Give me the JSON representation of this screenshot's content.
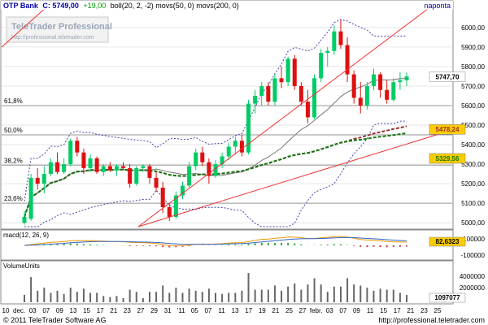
{
  "header": {
    "symbol": "OTP Bank",
    "close_label": "C: 5749,00",
    "change": "+19,00",
    "indicators": "boll(20, 2, -2) movs(50, 0) movs(200, 0)",
    "period": "naponta"
  },
  "watermark": {
    "title": "TeleTrader Professional",
    "url": "http://professional.teletrader.com"
  },
  "footer": {
    "copyright": "© 2011 TeleTrader Software AG",
    "url": "http://professional.teletrader.com"
  },
  "colors": {
    "up": "#00cc66",
    "down": "#dd1111",
    "boll": "#4444aa",
    "ma50": "#993333",
    "ma200": "#117711",
    "trend": "#ee3333",
    "panel_bg": "#ffffff",
    "grid": "#e6e6e6",
    "label_bg": "#ffcc00",
    "macd_label_bg": "#ffcc00"
  },
  "chart_data": [
    {
      "type": "candlestick",
      "title": "OTP Bank",
      "ylim": [
        4980,
        6120
      ],
      "y_ticks": [
        5000,
        5100,
        5200,
        5300,
        5400,
        5500,
        5600,
        5700,
        5800,
        5900,
        6000
      ],
      "y_tick_labels": [
        "5000,00",
        "5100,00",
        "5200,00",
        "5300,00",
        "5400,00",
        "5500,00",
        "5600,00",
        "5700,00",
        "5800,00",
        "5900,00",
        "6000,00"
      ],
      "fib_levels": [
        {
          "label": "61,8%",
          "value": 5600
        },
        {
          "label": "50,0%",
          "value": 5450
        },
        {
          "label": "38,2%",
          "value": 5295
        },
        {
          "label": "23,6%",
          "value": 5100
        }
      ],
      "last_value_labels": [
        {
          "text": "5747,70",
          "value": 5747.7,
          "kind": "price"
        },
        {
          "text": "5478,24",
          "value": 5478.24,
          "kind": "ma50"
        },
        {
          "text": "5329,56",
          "value": 5329.56,
          "kind": "ma200"
        }
      ],
      "candles": [
        {
          "d": "2010-11-30",
          "o": 5000,
          "h": 5060,
          "l": 4990,
          "c": 5030
        },
        {
          "d": "2010-12-01",
          "o": 5020,
          "h": 5250,
          "l": 5010,
          "c": 5230
        },
        {
          "d": "2010-12-02",
          "o": 5230,
          "h": 5280,
          "l": 5170,
          "c": 5200
        },
        {
          "d": "2010-12-03",
          "o": 5200,
          "h": 5290,
          "l": 5150,
          "c": 5250
        },
        {
          "d": "2010-12-06",
          "o": 5250,
          "h": 5330,
          "l": 5240,
          "c": 5310
        },
        {
          "d": "2010-12-07",
          "o": 5310,
          "h": 5360,
          "l": 5250,
          "c": 5260
        },
        {
          "d": "2010-12-08",
          "o": 5260,
          "h": 5330,
          "l": 5250,
          "c": 5300
        },
        {
          "d": "2010-12-09",
          "o": 5300,
          "h": 5430,
          "l": 5290,
          "c": 5420
        },
        {
          "d": "2010-12-10",
          "o": 5420,
          "h": 5440,
          "l": 5340,
          "c": 5360
        },
        {
          "d": "2010-12-13",
          "o": 5360,
          "h": 5380,
          "l": 5250,
          "c": 5280
        },
        {
          "d": "2010-12-14",
          "o": 5280,
          "h": 5350,
          "l": 5260,
          "c": 5330
        },
        {
          "d": "2010-12-15",
          "o": 5330,
          "h": 5340,
          "l": 5250,
          "c": 5260
        },
        {
          "d": "2010-12-16",
          "o": 5260,
          "h": 5300,
          "l": 5240,
          "c": 5290
        },
        {
          "d": "2010-12-17",
          "o": 5290,
          "h": 5310,
          "l": 5260,
          "c": 5270
        },
        {
          "d": "2010-12-20",
          "o": 5270,
          "h": 5300,
          "l": 5240,
          "c": 5290
        },
        {
          "d": "2010-12-21",
          "o": 5290,
          "h": 5310,
          "l": 5270,
          "c": 5280
        },
        {
          "d": "2010-12-22",
          "o": 5280,
          "h": 5300,
          "l": 5180,
          "c": 5200
        },
        {
          "d": "2010-12-23",
          "o": 5200,
          "h": 5290,
          "l": 5190,
          "c": 5280
        },
        {
          "d": "2010-12-24",
          "o": 5280,
          "h": 5300,
          "l": 5260,
          "c": 5290
        },
        {
          "d": "2010-12-27",
          "o": 5290,
          "h": 5300,
          "l": 5200,
          "c": 5230
        },
        {
          "d": "2010-12-28",
          "o": 5230,
          "h": 5260,
          "l": 5160,
          "c": 5180
        },
        {
          "d": "2010-12-29",
          "o": 5180,
          "h": 5210,
          "l": 5050,
          "c": 5080
        },
        {
          "d": "2010-12-30",
          "o": 5080,
          "h": 5100,
          "l": 5010,
          "c": 5030
        },
        {
          "d": "2010-12-31",
          "o": 5030,
          "h": 5160,
          "l": 5020,
          "c": 5140
        },
        {
          "d": "2011-01-03",
          "o": 5140,
          "h": 5210,
          "l": 5120,
          "c": 5190
        },
        {
          "d": "2011-01-04",
          "o": 5190,
          "h": 5310,
          "l": 5180,
          "c": 5290
        },
        {
          "d": "2011-01-05",
          "o": 5290,
          "h": 5380,
          "l": 5270,
          "c": 5360
        },
        {
          "d": "2011-01-06",
          "o": 5360,
          "h": 5390,
          "l": 5290,
          "c": 5310
        },
        {
          "d": "2011-01-07",
          "o": 5310,
          "h": 5330,
          "l": 5200,
          "c": 5240
        },
        {
          "d": "2011-01-10",
          "o": 5240,
          "h": 5320,
          "l": 5230,
          "c": 5300
        },
        {
          "d": "2011-01-11",
          "o": 5300,
          "h": 5360,
          "l": 5280,
          "c": 5340
        },
        {
          "d": "2011-01-12",
          "o": 5340,
          "h": 5410,
          "l": 5320,
          "c": 5390
        },
        {
          "d": "2011-01-13",
          "o": 5390,
          "h": 5440,
          "l": 5350,
          "c": 5420
        },
        {
          "d": "2011-01-14",
          "o": 5420,
          "h": 5450,
          "l": 5340,
          "c": 5360
        },
        {
          "d": "2011-01-17",
          "o": 5360,
          "h": 5630,
          "l": 5350,
          "c": 5610
        },
        {
          "d": "2011-01-18",
          "o": 5610,
          "h": 5680,
          "l": 5560,
          "c": 5650
        },
        {
          "d": "2011-01-19",
          "o": 5650,
          "h": 5720,
          "l": 5600,
          "c": 5700
        },
        {
          "d": "2011-01-20",
          "o": 5700,
          "h": 5720,
          "l": 5600,
          "c": 5620
        },
        {
          "d": "2011-01-21",
          "o": 5620,
          "h": 5760,
          "l": 5600,
          "c": 5740
        },
        {
          "d": "2011-01-24",
          "o": 5740,
          "h": 5800,
          "l": 5690,
          "c": 5720
        },
        {
          "d": "2011-01-25",
          "o": 5720,
          "h": 5850,
          "l": 5700,
          "c": 5840
        },
        {
          "d": "2011-01-26",
          "o": 5840,
          "h": 5860,
          "l": 5680,
          "c": 5700
        },
        {
          "d": "2011-01-27",
          "o": 5700,
          "h": 5720,
          "l": 5600,
          "c": 5620
        },
        {
          "d": "2011-01-28",
          "o": 5620,
          "h": 5680,
          "l": 5510,
          "c": 5540
        },
        {
          "d": "2011-01-31",
          "o": 5540,
          "h": 5760,
          "l": 5530,
          "c": 5740
        },
        {
          "d": "2011-02-01",
          "o": 5740,
          "h": 5890,
          "l": 5720,
          "c": 5870
        },
        {
          "d": "2011-02-02",
          "o": 5870,
          "h": 5900,
          "l": 5800,
          "c": 5880
        },
        {
          "d": "2011-02-03",
          "o": 5880,
          "h": 6010,
          "l": 5860,
          "c": 5980
        },
        {
          "d": "2011-02-04",
          "o": 5980,
          "h": 6040,
          "l": 5890,
          "c": 5910
        },
        {
          "d": "2011-02-07",
          "o": 5910,
          "h": 5950,
          "l": 5720,
          "c": 5760
        },
        {
          "d": "2011-02-08",
          "o": 5760,
          "h": 5780,
          "l": 5610,
          "c": 5640
        },
        {
          "d": "2011-02-09",
          "o": 5640,
          "h": 5720,
          "l": 5560,
          "c": 5600
        },
        {
          "d": "2011-02-10",
          "o": 5600,
          "h": 5720,
          "l": 5580,
          "c": 5700
        },
        {
          "d": "2011-02-11",
          "o": 5700,
          "h": 5790,
          "l": 5680,
          "c": 5760
        },
        {
          "d": "2011-02-14",
          "o": 5760,
          "h": 5770,
          "l": 5640,
          "c": 5680
        },
        {
          "d": "2011-02-15",
          "o": 5680,
          "h": 5730,
          "l": 5610,
          "c": 5630
        },
        {
          "d": "2011-02-16",
          "o": 5630,
          "h": 5740,
          "l": 5620,
          "c": 5720
        },
        {
          "d": "2011-02-17",
          "o": 5720,
          "h": 5770,
          "l": 5680,
          "c": 5730
        },
        {
          "d": "2011-02-18",
          "o": 5730,
          "h": 5770,
          "l": 5700,
          "c": 5749
        }
      ]
    },
    {
      "type": "line",
      "title": "macd(12, 26, 9)",
      "y_tick_labels": [
        "100000",
        "-100000"
      ],
      "last_value_labels": [
        {
          "text": "82,6323",
          "kind": "macd"
        }
      ]
    },
    {
      "type": "bar",
      "title": "VolumeUnits",
      "y_tick_labels": [
        "4000000",
        "2000000"
      ],
      "last_value_labels": [
        {
          "text": "1097077",
          "kind": "volume"
        }
      ]
    }
  ],
  "x_axis": {
    "labels": [
      "10",
      "dec.",
      "03",
      "07",
      "09",
      "13",
      "15",
      "17",
      "21",
      "23",
      "27",
      "29",
      "31",
      "'11",
      "05",
      "07",
      "11",
      "13",
      "17",
      "19",
      "21",
      "25",
      "27",
      "febr.",
      "03",
      "07",
      "09",
      "11",
      "15",
      "17",
      "21",
      "23",
      "25"
    ]
  }
}
